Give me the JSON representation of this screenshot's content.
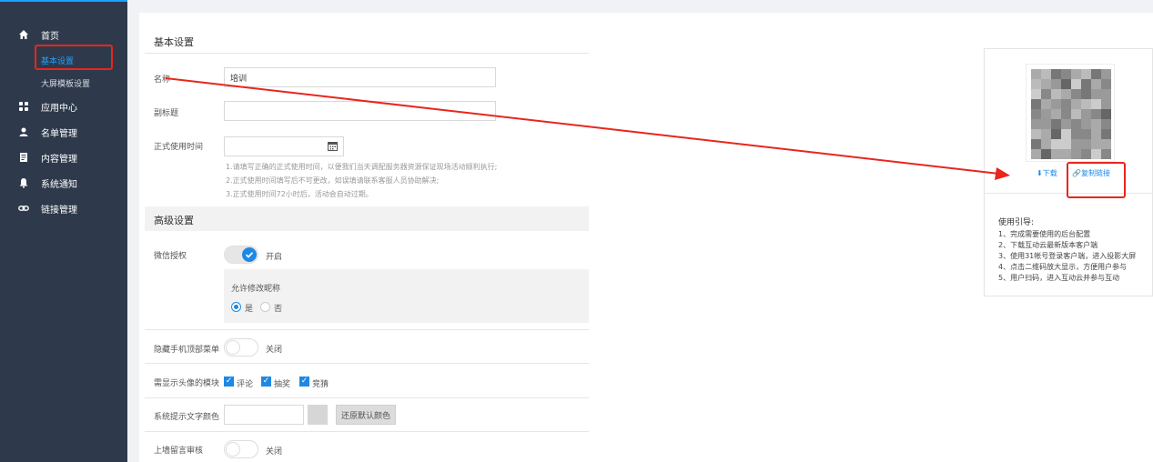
{
  "sidebar": {
    "home": "首页",
    "home_sub": [
      "基本设置",
      "大屏模板设置"
    ],
    "items": [
      "应用中心",
      "名单管理",
      "内容管理",
      "系统通知",
      "链接管理"
    ]
  },
  "basic": {
    "title": "基本设置",
    "name_label": "名称",
    "name_value": "培训",
    "subtitle_label": "副标题",
    "subtitle_value": "",
    "time_label": "正式使用时间",
    "time_value": "",
    "tips": [
      "1.请填写正确的正式使用时间，以便我们当天调配服务器资源保证现场活动顺利执行;",
      "2.正式使用时间填写后不可更改，如误填请联系客服人员协助解决;",
      "3.正式使用时间72小时后，活动会自动过期。"
    ]
  },
  "advanced": {
    "title": "高级设置",
    "wechat_label": "微信授权",
    "wechat_state": "开启",
    "nickname_label": "允许修改昵称",
    "yes": "是",
    "no": "否",
    "hide_menu_label": "隐藏手机顶部菜单",
    "hide_menu_state": "关闭",
    "avatar_label": "需显示头像的模块",
    "avatar_modules": [
      "评论",
      "抽奖",
      "竞猜"
    ],
    "color_label": "系统提示文字颜色",
    "color_value": "",
    "restore_button": "还原默认颜色",
    "wall_label": "上墙留言审核",
    "wall_state": "关闭"
  },
  "card": {
    "download": "下载",
    "copy_link": "复制链接",
    "guide_title": "使用引导:",
    "guide": [
      "1、完成需要使用的后台配置",
      "2、下载互动云最新版本客户端",
      "3、使用31帐号登录客户端，进入投影大屏",
      "4、点击二维码放大显示，方便用户参与",
      "5、用户扫码，进入互动云并参与互动"
    ]
  },
  "colors": {
    "sidebar_bg": "#2e3a4b",
    "accent": "#1e88e5",
    "annotation": "#e8261c"
  }
}
